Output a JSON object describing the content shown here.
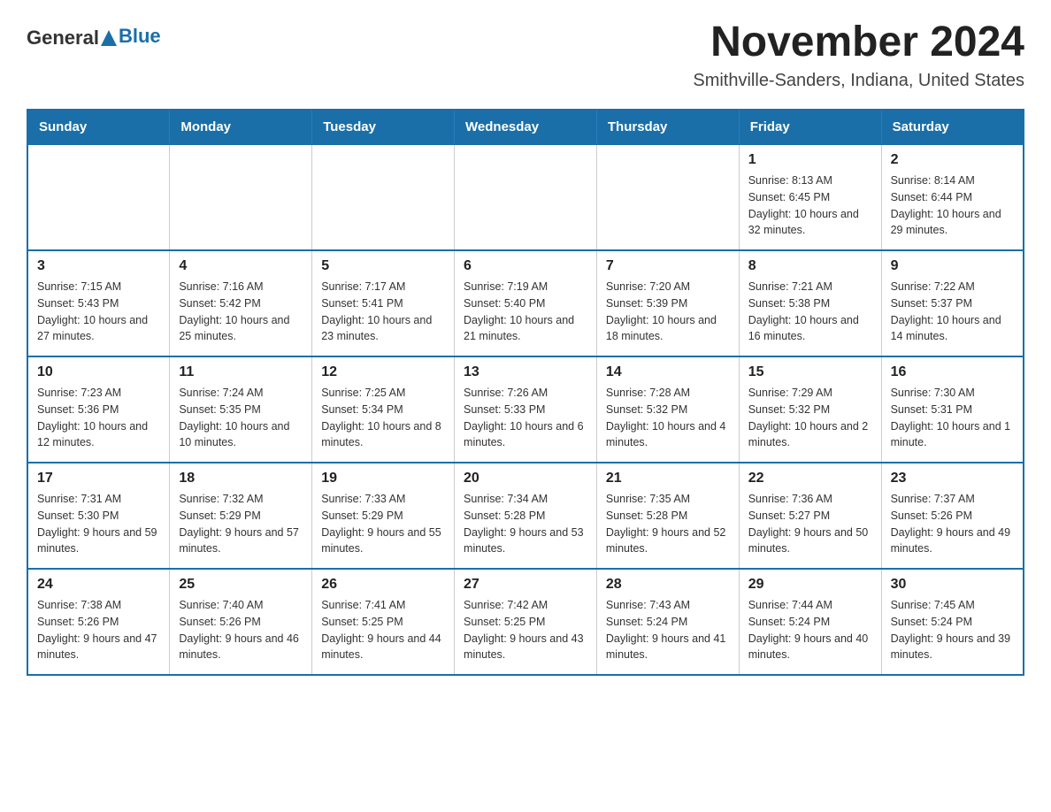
{
  "header": {
    "logo_general": "General",
    "logo_blue": "Blue",
    "main_title": "November 2024",
    "subtitle": "Smithville-Sanders, Indiana, United States"
  },
  "calendar": {
    "weekdays": [
      "Sunday",
      "Monday",
      "Tuesday",
      "Wednesday",
      "Thursday",
      "Friday",
      "Saturday"
    ],
    "weeks": [
      [
        {
          "day": "",
          "info": ""
        },
        {
          "day": "",
          "info": ""
        },
        {
          "day": "",
          "info": ""
        },
        {
          "day": "",
          "info": ""
        },
        {
          "day": "",
          "info": ""
        },
        {
          "day": "1",
          "info": "Sunrise: 8:13 AM\nSunset: 6:45 PM\nDaylight: 10 hours and 32 minutes."
        },
        {
          "day": "2",
          "info": "Sunrise: 8:14 AM\nSunset: 6:44 PM\nDaylight: 10 hours and 29 minutes."
        }
      ],
      [
        {
          "day": "3",
          "info": "Sunrise: 7:15 AM\nSunset: 5:43 PM\nDaylight: 10 hours and 27 minutes."
        },
        {
          "day": "4",
          "info": "Sunrise: 7:16 AM\nSunset: 5:42 PM\nDaylight: 10 hours and 25 minutes."
        },
        {
          "day": "5",
          "info": "Sunrise: 7:17 AM\nSunset: 5:41 PM\nDaylight: 10 hours and 23 minutes."
        },
        {
          "day": "6",
          "info": "Sunrise: 7:19 AM\nSunset: 5:40 PM\nDaylight: 10 hours and 21 minutes."
        },
        {
          "day": "7",
          "info": "Sunrise: 7:20 AM\nSunset: 5:39 PM\nDaylight: 10 hours and 18 minutes."
        },
        {
          "day": "8",
          "info": "Sunrise: 7:21 AM\nSunset: 5:38 PM\nDaylight: 10 hours and 16 minutes."
        },
        {
          "day": "9",
          "info": "Sunrise: 7:22 AM\nSunset: 5:37 PM\nDaylight: 10 hours and 14 minutes."
        }
      ],
      [
        {
          "day": "10",
          "info": "Sunrise: 7:23 AM\nSunset: 5:36 PM\nDaylight: 10 hours and 12 minutes."
        },
        {
          "day": "11",
          "info": "Sunrise: 7:24 AM\nSunset: 5:35 PM\nDaylight: 10 hours and 10 minutes."
        },
        {
          "day": "12",
          "info": "Sunrise: 7:25 AM\nSunset: 5:34 PM\nDaylight: 10 hours and 8 minutes."
        },
        {
          "day": "13",
          "info": "Sunrise: 7:26 AM\nSunset: 5:33 PM\nDaylight: 10 hours and 6 minutes."
        },
        {
          "day": "14",
          "info": "Sunrise: 7:28 AM\nSunset: 5:32 PM\nDaylight: 10 hours and 4 minutes."
        },
        {
          "day": "15",
          "info": "Sunrise: 7:29 AM\nSunset: 5:32 PM\nDaylight: 10 hours and 2 minutes."
        },
        {
          "day": "16",
          "info": "Sunrise: 7:30 AM\nSunset: 5:31 PM\nDaylight: 10 hours and 1 minute."
        }
      ],
      [
        {
          "day": "17",
          "info": "Sunrise: 7:31 AM\nSunset: 5:30 PM\nDaylight: 9 hours and 59 minutes."
        },
        {
          "day": "18",
          "info": "Sunrise: 7:32 AM\nSunset: 5:29 PM\nDaylight: 9 hours and 57 minutes."
        },
        {
          "day": "19",
          "info": "Sunrise: 7:33 AM\nSunset: 5:29 PM\nDaylight: 9 hours and 55 minutes."
        },
        {
          "day": "20",
          "info": "Sunrise: 7:34 AM\nSunset: 5:28 PM\nDaylight: 9 hours and 53 minutes."
        },
        {
          "day": "21",
          "info": "Sunrise: 7:35 AM\nSunset: 5:28 PM\nDaylight: 9 hours and 52 minutes."
        },
        {
          "day": "22",
          "info": "Sunrise: 7:36 AM\nSunset: 5:27 PM\nDaylight: 9 hours and 50 minutes."
        },
        {
          "day": "23",
          "info": "Sunrise: 7:37 AM\nSunset: 5:26 PM\nDaylight: 9 hours and 49 minutes."
        }
      ],
      [
        {
          "day": "24",
          "info": "Sunrise: 7:38 AM\nSunset: 5:26 PM\nDaylight: 9 hours and 47 minutes."
        },
        {
          "day": "25",
          "info": "Sunrise: 7:40 AM\nSunset: 5:26 PM\nDaylight: 9 hours and 46 minutes."
        },
        {
          "day": "26",
          "info": "Sunrise: 7:41 AM\nSunset: 5:25 PM\nDaylight: 9 hours and 44 minutes."
        },
        {
          "day": "27",
          "info": "Sunrise: 7:42 AM\nSunset: 5:25 PM\nDaylight: 9 hours and 43 minutes."
        },
        {
          "day": "28",
          "info": "Sunrise: 7:43 AM\nSunset: 5:24 PM\nDaylight: 9 hours and 41 minutes."
        },
        {
          "day": "29",
          "info": "Sunrise: 7:44 AM\nSunset: 5:24 PM\nDaylight: 9 hours and 40 minutes."
        },
        {
          "day": "30",
          "info": "Sunrise: 7:45 AM\nSunset: 5:24 PM\nDaylight: 9 hours and 39 minutes."
        }
      ]
    ]
  }
}
